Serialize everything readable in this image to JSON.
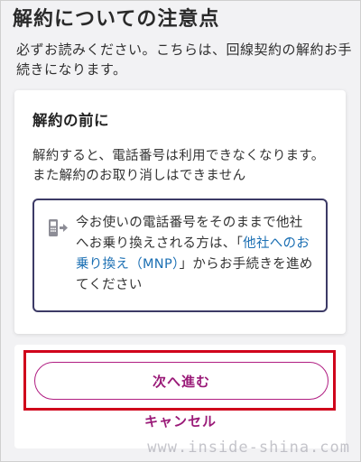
{
  "header": {
    "title": "解約についての注意点",
    "subtitle": "必ずお読みください。こちらは、回線契約の解約お手続きになります。"
  },
  "card": {
    "title": "解約の前に",
    "body": "解約すると、電話番号は利用できなくなります。また解約のお取り消しはできません",
    "notice": {
      "icon": "phone-transfer-icon",
      "text_before": "今お使いの電話番号をそのままで他社へお乗り換えされる方は、「",
      "link_text": "他社へのお乗り換え（MNP）",
      "text_after": "」からお手続きを進めてください"
    }
  },
  "actions": {
    "next_label": "次へ進む",
    "cancel_label": "キャンセル"
  },
  "watermark": "www.inside-shina.com",
  "colors": {
    "accent": "#9a1a78",
    "link": "#1b6fb3",
    "notice_border": "#3c3a66",
    "highlight": "#d0021b"
  }
}
